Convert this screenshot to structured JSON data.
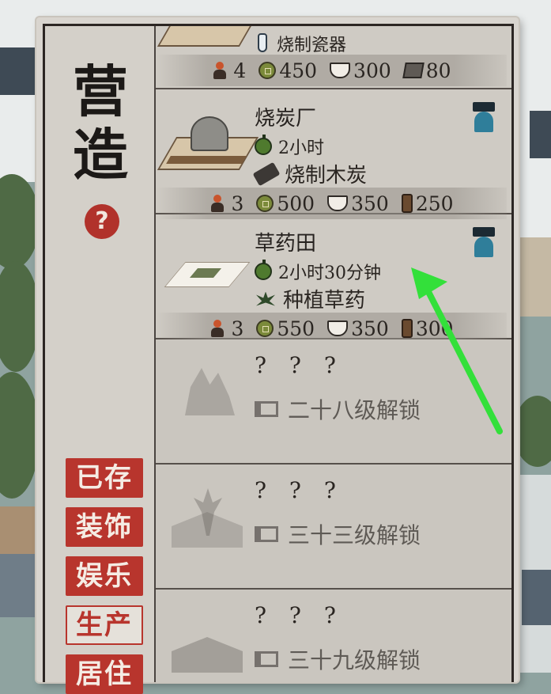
{
  "panel": {
    "title_chars": [
      "营",
      "造"
    ],
    "help_label": "?"
  },
  "categories": [
    {
      "label": "已存",
      "active": false
    },
    {
      "label": "装饰",
      "active": false
    },
    {
      "label": "娱乐",
      "active": false
    },
    {
      "label": "生产",
      "active": true
    },
    {
      "label": "居住",
      "active": false
    }
  ],
  "buildings": [
    {
      "name": "",
      "product": "烧制瓷器",
      "product_icon": "kiln-icon",
      "costs": [
        {
          "icon": "worker-icon",
          "value": "4"
        },
        {
          "icon": "coin-icon",
          "value": "450"
        },
        {
          "icon": "rice-icon",
          "value": "300"
        },
        {
          "icon": "stone-icon",
          "value": "80"
        }
      ]
    },
    {
      "name": "烧炭厂",
      "time": "2小时",
      "product": "烧制木炭",
      "product_icon": "charcoal-log-icon",
      "costs": [
        {
          "icon": "worker-icon",
          "value": "3"
        },
        {
          "icon": "coin-icon",
          "value": "500"
        },
        {
          "icon": "rice-icon",
          "value": "350"
        },
        {
          "icon": "wood-icon",
          "value": "250"
        }
      ]
    },
    {
      "name": "草药田",
      "time": "2小时30分钟",
      "product": "种植草药",
      "product_icon": "herb-icon",
      "costs": [
        {
          "icon": "worker-icon",
          "value": "3"
        },
        {
          "icon": "coin-icon",
          "value": "550"
        },
        {
          "icon": "rice-icon",
          "value": "350"
        },
        {
          "icon": "wood-icon",
          "value": "300"
        }
      ]
    }
  ],
  "locked": [
    {
      "name": "? ? ?",
      "condition": "二十八级解锁"
    },
    {
      "name": "? ? ?",
      "condition": "三十三级解锁"
    },
    {
      "name": "? ? ?",
      "condition": "三十九级解锁"
    }
  ],
  "colors": {
    "accent_red": "#b8352d",
    "annotation_arrow": "#33e03a"
  }
}
